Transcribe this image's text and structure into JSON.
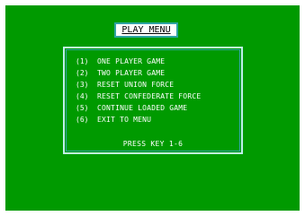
{
  "title": "PLAY MENU",
  "menu": {
    "items": [
      {
        "key": "(1)",
        "label": "ONE PLAYER GAME"
      },
      {
        "key": "(2)",
        "label": "TWO PLAYER GAME"
      },
      {
        "key": "(3)",
        "label": "RESET UNION FORCE"
      },
      {
        "key": "(4)",
        "label": "RESET CONFEDERATE FORCE"
      },
      {
        "key": "(5)",
        "label": "CONTINUE LOADED GAME"
      },
      {
        "key": "(6)",
        "label": "EXIT TO MENU"
      }
    ],
    "prompt": "PRESS KEY 1-6"
  },
  "colors": {
    "background": "#009a00",
    "border": "#ffffff",
    "frame_accent": "#2fa3a3",
    "text": "#ffffff"
  }
}
